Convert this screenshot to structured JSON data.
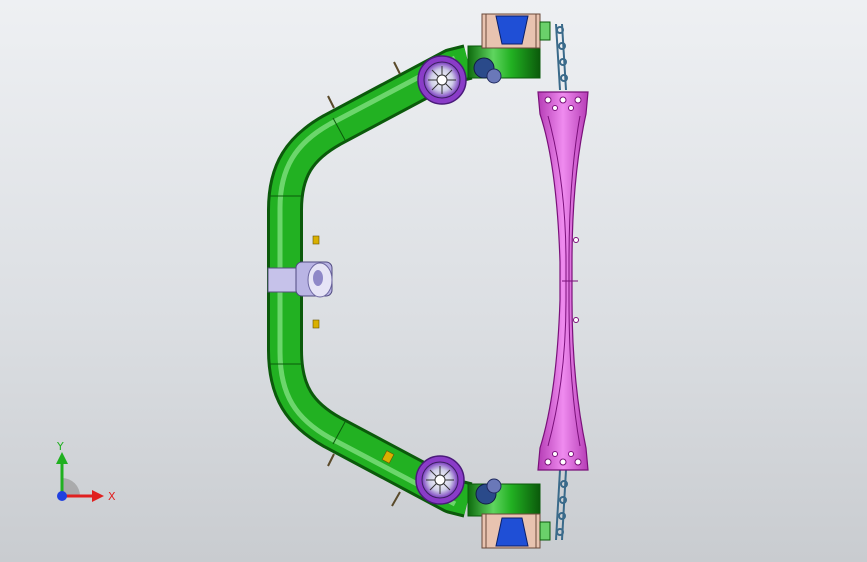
{
  "viewport": {
    "background_top": "#eef0f3",
    "background_bottom": "#c9ccd0"
  },
  "colors": {
    "tube": "#22b122",
    "tube_dark": "#107010",
    "tube_light": "#7fe07f",
    "mount": "#d76bd7",
    "mount_dark": "#8a208a",
    "bushing": "#c6c2ea",
    "bracket_blue": "#1f4fd6",
    "bracket_tan": "#e8c3b0",
    "hub_purple": "#8a3cc8",
    "axis_x": "#e02020",
    "axis_y": "#20b020",
    "axis_z": "#2040e0"
  },
  "triad": {
    "x_label": "X",
    "y_label": "Y"
  }
}
